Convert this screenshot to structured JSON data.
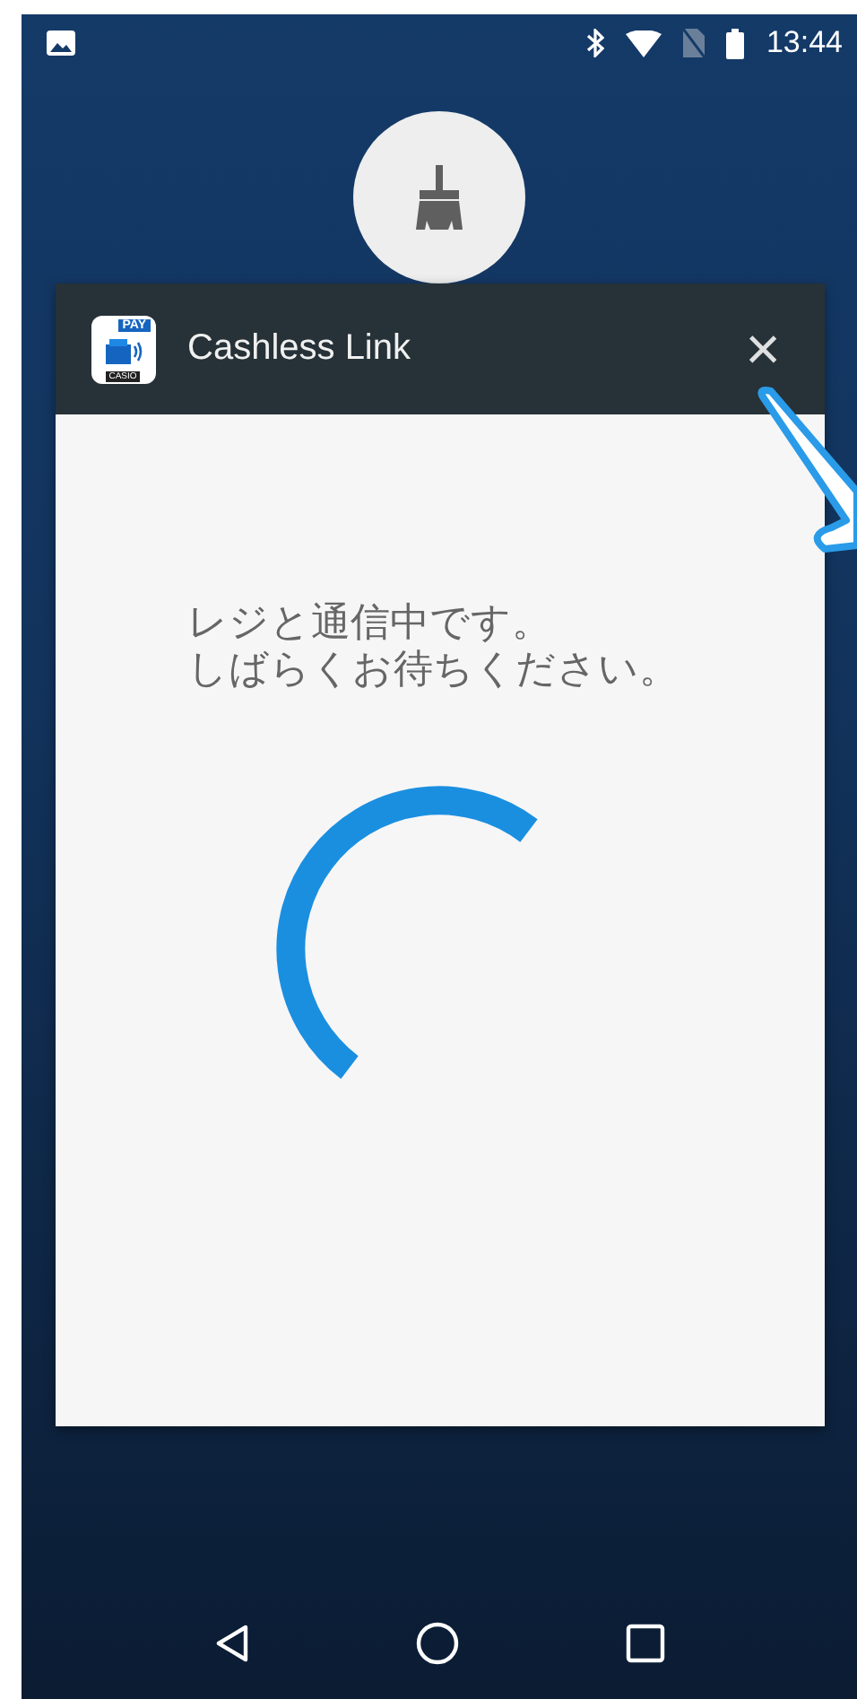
{
  "status_bar": {
    "time": "13:44"
  },
  "app_card": {
    "title": "Cashless Link",
    "close_label": "×",
    "app_icon_text": "PAY",
    "app_icon_brand": "CASIO",
    "message_lines": [
      "レジと通信中です。",
      "しばらくお待ちください。"
    ],
    "spinner": {
      "kind": "arc"
    }
  }
}
